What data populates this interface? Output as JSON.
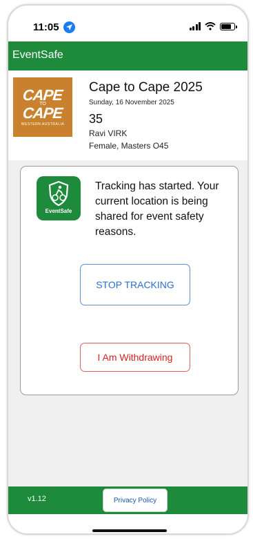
{
  "status_bar": {
    "time": "11:05"
  },
  "app_bar": {
    "title": "EventSafe"
  },
  "event": {
    "title": "Cape to Cape 2025",
    "date": "Sunday, 16 November 2025",
    "bib": "35",
    "participant": "Ravi VIRK",
    "category": "Female, Masters O45",
    "logo": {
      "line1": "CAPE",
      "middle": "TO",
      "line2": "CAPE",
      "sub": "WESTERN AUSTRALIA"
    }
  },
  "tracking": {
    "app_icon_label": "EventSafe",
    "message": "Tracking has started. Your current location is being shared for event safety reasons.",
    "stop_button": "STOP TRACKING",
    "withdraw_button": "I Am Withdrawing"
  },
  "footer": {
    "version": "v1.12",
    "privacy_button": "Privacy Policy"
  },
  "colors": {
    "brand_green": "#1e8a3c",
    "stop_blue": "#2a6fd0",
    "withdraw_red": "#d42020",
    "logo_orange": "#c9812e"
  },
  "icons": [
    "location-arrow-icon",
    "signal-icon",
    "wifi-icon",
    "battery-icon",
    "cyclist-shield-icon"
  ]
}
